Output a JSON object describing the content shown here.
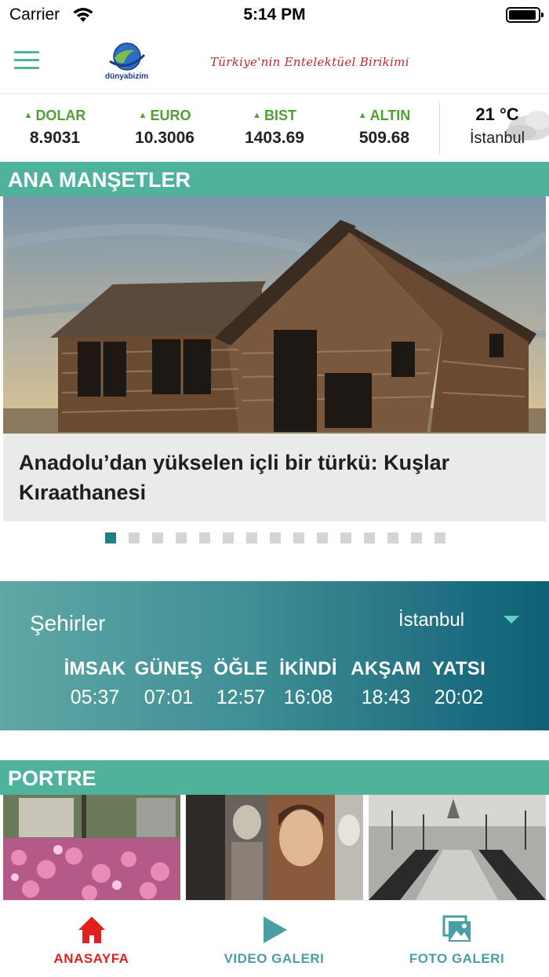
{
  "status_bar": {
    "carrier": "Carrier",
    "time": "5:14 PM"
  },
  "header": {
    "logo_text": "dünyabizim",
    "slogan": "Türkiye'nin Entelektüel Birikimi"
  },
  "markets": [
    {
      "name": "DOLAR",
      "value": "8.9031",
      "trend": "up"
    },
    {
      "name": "EURO",
      "value": "10.3006",
      "trend": "up"
    },
    {
      "name": "BIST",
      "value": "1403.69",
      "trend": "up"
    },
    {
      "name": "ALTIN",
      "value": "509.68",
      "trend": "up"
    }
  ],
  "weather": {
    "temperature": "21 °C",
    "city": "İstanbul",
    "icon": "cloud-icon"
  },
  "headlines": {
    "section_title": "ANA MANŞETLER",
    "current_title": "Anadolu’dan yükselen içli bir türkü: Kuşlar Kıraathanesi",
    "slide_count": 15,
    "active_slide": 1
  },
  "prayer": {
    "cities_label": "Şehirler",
    "selected_city": "İstanbul",
    "times": [
      {
        "name": "İMSAK",
        "time": "05:37"
      },
      {
        "name": "GÜNEŞ",
        "time": "07:01"
      },
      {
        "name": "ÖĞLE",
        "time": "12:57"
      },
      {
        "name": "İKİNDİ",
        "time": "16:08"
      },
      {
        "name": "AKŞAM",
        "time": "18:43"
      },
      {
        "name": "YATSI",
        "time": "20:02"
      }
    ]
  },
  "portre": {
    "section_title": "PORTRE"
  },
  "tabs": [
    {
      "label": "ANASAYFA",
      "icon": "home-icon",
      "active": true
    },
    {
      "label": "VIDEO GALERI",
      "icon": "play-icon",
      "active": false
    },
    {
      "label": "FOTO GALERI",
      "icon": "photo-gallery-icon",
      "active": false
    }
  ],
  "colors": {
    "accent": "#4fb39c",
    "active_tab": "#e0201f",
    "inactive_tab": "#4a9fa6",
    "market_up": "#4fa136"
  }
}
